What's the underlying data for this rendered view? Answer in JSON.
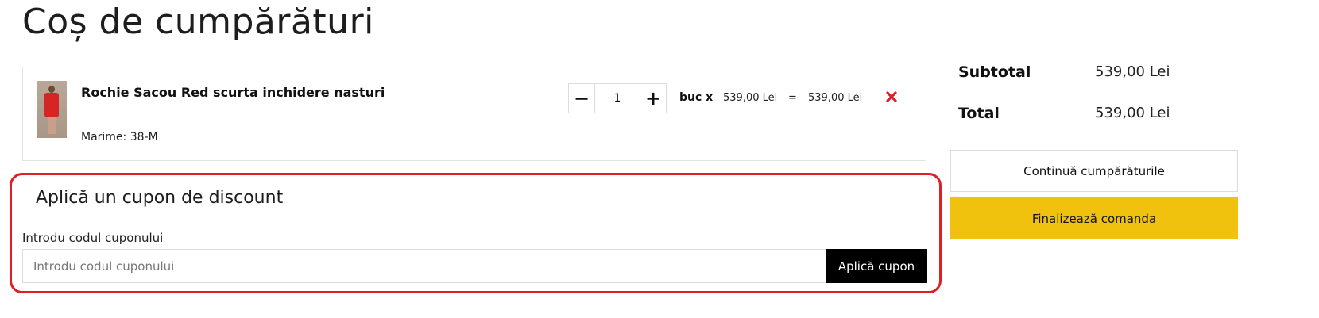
{
  "page": {
    "title": "Coș de cumpărături"
  },
  "cart": {
    "item": {
      "name": "Rochie Sacou Red scurta inchidere nasturi",
      "size": "Marime: 38-M",
      "quantity": "1",
      "unit": "buc x",
      "unit_price": "539,00 Lei",
      "equals": "=",
      "total_price": "539,00 Lei",
      "minus_symbol": "−",
      "plus_symbol": "+",
      "remove_icon": "close-icon",
      "remove_color": "#e01e26"
    }
  },
  "coupon": {
    "title": "Aplică un cupon de discount",
    "label": "Introdu codul cuponului",
    "placeholder": "Introdu codul cuponului",
    "button": "Aplică cupon",
    "highlight_color": "#e01e26"
  },
  "summary": {
    "subtotal_label": "Subtotal",
    "subtotal_value": "539,00 Lei",
    "total_label": "Total",
    "total_value": "539,00 Lei",
    "continue_button": "Continuă cumpărăturile",
    "checkout_button": "Finalizează comanda",
    "checkout_color": "#f0c20e"
  }
}
